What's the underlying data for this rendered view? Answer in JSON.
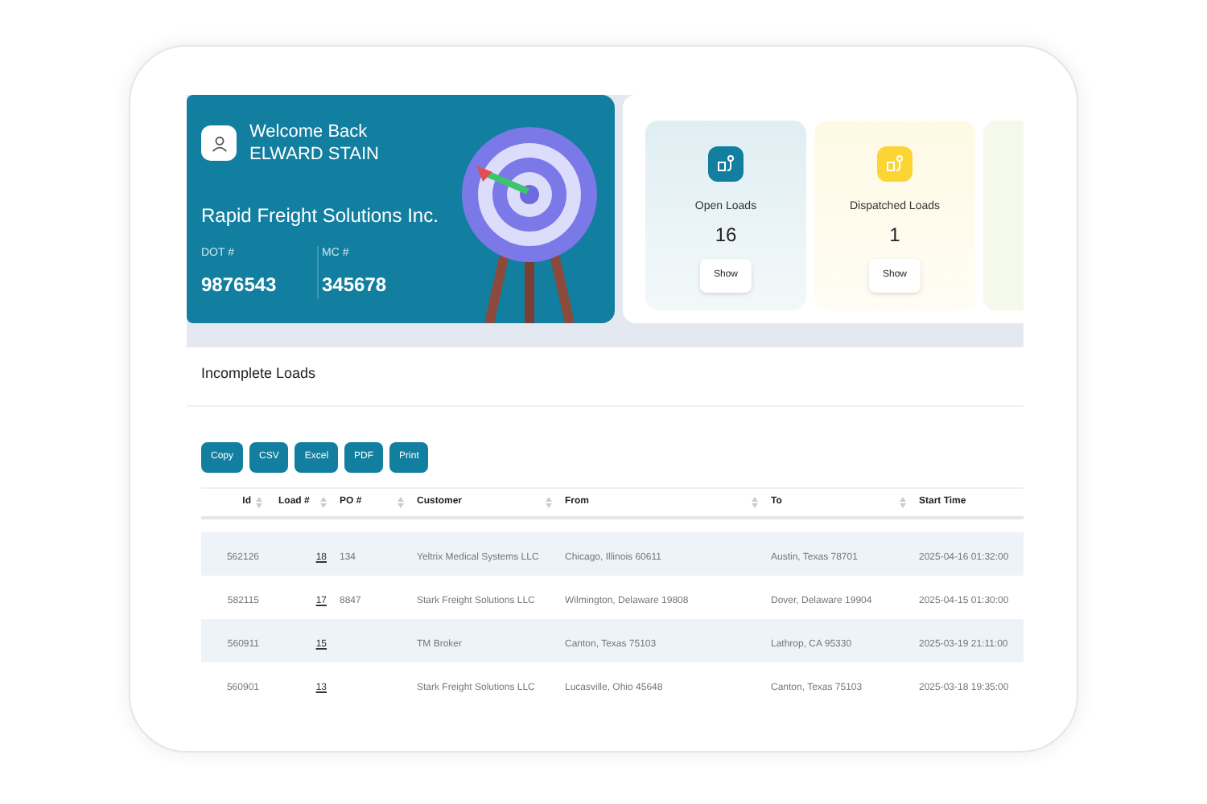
{
  "welcome": {
    "greeting": "Welcome Back",
    "user": "ELWARD STAIN",
    "company": "Rapid Freight Solutions Inc.",
    "ids": [
      {
        "label": "DOT #",
        "value": "9876543"
      },
      {
        "label": "MC #",
        "value": "345678"
      }
    ]
  },
  "stats": [
    {
      "label": "Open Loads",
      "count": "16",
      "button": "Show",
      "color": "#127fa0"
    },
    {
      "label": "Dispatched Loads",
      "count": "1",
      "button": "Show",
      "color": "#fcd535"
    }
  ],
  "section_title": "Incomplete Loads",
  "export_buttons": [
    "Copy",
    "CSV",
    "Excel",
    "PDF",
    "Print"
  ],
  "table": {
    "columns": [
      "Id",
      "Load #",
      "PO #",
      "Customer",
      "From",
      "To",
      "Start Time"
    ],
    "rows": [
      {
        "cells": [
          "562126",
          "18",
          "134",
          "Yeltrix Medical Systems LLC",
          "Chicago, Illinois 60611",
          "Austin, Texas 78701",
          "2025-04-16 01:32:00"
        ]
      },
      {
        "cells": [
          "582115",
          "17",
          "8847",
          "Stark Freight Solutions LLC",
          "Wilmington, Delaware 19808",
          "Dover, Delaware 19904",
          "2025-04-15 01:30:00"
        ]
      },
      {
        "cells": [
          "560911",
          "15",
          "",
          "TM Broker",
          "Canton, Texas 75103",
          "Lathrop, CA 95330",
          "2025-03-19 21:11:00"
        ]
      },
      {
        "cells": [
          "560901",
          "13",
          "",
          "Stark Freight Solutions LLC",
          "Lucasville, Ohio 45648",
          "Canton, Texas 75103",
          "2025-03-18 19:35:00"
        ]
      }
    ]
  }
}
